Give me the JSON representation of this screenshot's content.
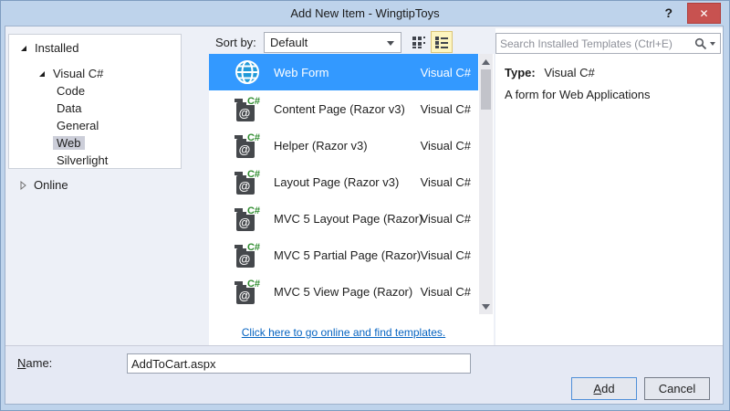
{
  "window": {
    "title": "Add New Item - WingtipToys",
    "help": "?",
    "close": "✕"
  },
  "sidebar": {
    "installed_label": "Installed",
    "visual_csharp_label": "Visual C#",
    "categories": [
      "Code",
      "Data",
      "General",
      "Web",
      "Silverlight"
    ],
    "selected_category": "Web",
    "online_label": "Online"
  },
  "toolbar": {
    "sort_label": "Sort by:",
    "sort_value": "Default"
  },
  "templates": {
    "items": [
      {
        "name": "Web Form",
        "language": "Visual C#",
        "icon": "globe-icon",
        "selected": true
      },
      {
        "name": "Content Page (Razor v3)",
        "language": "Visual C#",
        "icon": "razor-page-icon",
        "selected": false
      },
      {
        "name": "Helper (Razor v3)",
        "language": "Visual C#",
        "icon": "razor-page-icon",
        "selected": false
      },
      {
        "name": "Layout Page (Razor v3)",
        "language": "Visual C#",
        "icon": "razor-page-icon",
        "selected": false
      },
      {
        "name": "MVC 5 Layout Page (Razor)",
        "language": "Visual C#",
        "icon": "razor-page-icon",
        "selected": false
      },
      {
        "name": "MVC 5 Partial Page (Razor)",
        "language": "Visual C#",
        "icon": "razor-page-icon",
        "selected": false
      },
      {
        "name": "MVC 5 View Page (Razor)",
        "language": "Visual C#",
        "icon": "razor-page-icon",
        "selected": false
      }
    ],
    "online_link": "Click here to go online and find templates."
  },
  "search": {
    "placeholder": "Search Installed Templates (Ctrl+E)"
  },
  "details": {
    "type_label": "Type:",
    "type_value": "Visual C#",
    "description": "A form for Web Applications"
  },
  "footer": {
    "name_label_initial": "N",
    "name_label_rest": "ame:",
    "name_value": "AddToCart.aspx",
    "add_initial": "A",
    "add_rest": "dd",
    "cancel_label": "Cancel"
  },
  "colors": {
    "titlebar": "#bed3eb",
    "selection_blue": "#3399ff",
    "close_red": "#c85250",
    "link_blue": "#0563c1",
    "category_selection_gray": "#ccced9",
    "view_toggle_active_bg": "#fdf5c0",
    "view_toggle_active_border": "#dcc577"
  }
}
